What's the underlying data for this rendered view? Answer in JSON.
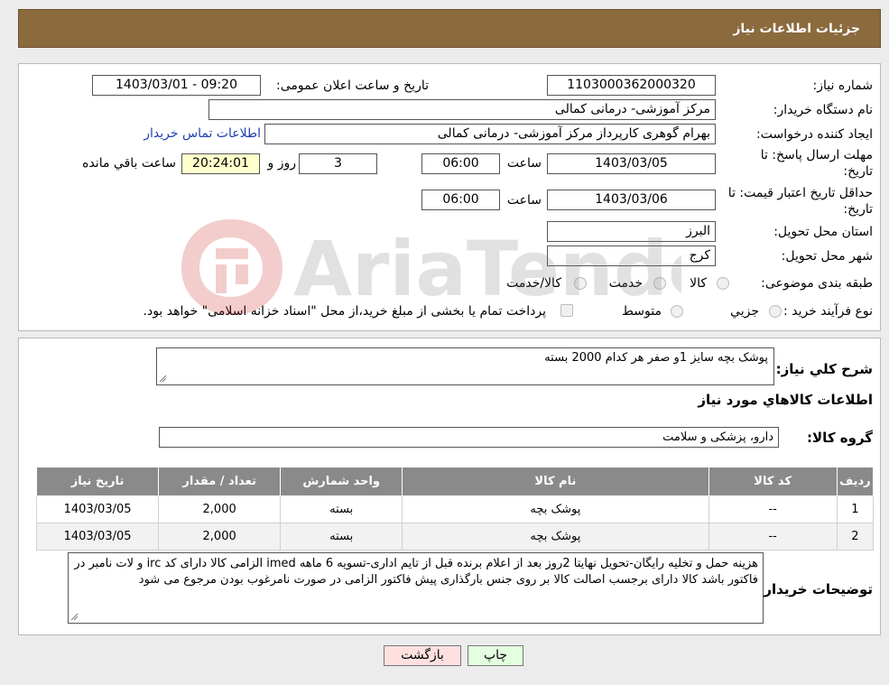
{
  "header": {
    "title": "جزئیات اطلاعات نیاز"
  },
  "form": {
    "need_number_label": "شماره نیاز:",
    "need_number": "1103000362000320",
    "announce_label": "تاریخ و ساعت اعلان عمومی:",
    "announce_value": "1403/03/01 - 09:20",
    "buyer_org_label": "نام دستگاه خریدار:",
    "buyer_org": "مرکز آموزشی- درمانی کمالی",
    "creator_label": "ایجاد کننده درخواست:",
    "creator": "بهرام گوهری کارپرداز مرکز آموزشی- درمانی کمالی",
    "contact_link": "اطلاعات تماس خریدار",
    "deadline_label_1": "مهلت ارسال پاسخ: تا",
    "deadline_label_2": "تاریخ:",
    "deadline_date": "1403/03/05",
    "time_label": "ساعت",
    "deadline_time": "06:00",
    "days_value": "3",
    "days_label": "روز و",
    "remaining_time": "20:24:01",
    "remaining_label": "ساعت باقي مانده",
    "validity_label_1": "حداقل تاریخ اعتبار قیمت: تا",
    "validity_label_2": "تاریخ:",
    "validity_date": "1403/03/06",
    "validity_time": "06:00",
    "province_label": "استان محل تحویل:",
    "province": "البرز",
    "city_label": "شهر محل تحویل:",
    "city": "کرج",
    "category_label": "طبقه بندی موضوعی:",
    "category_options": [
      "کالا",
      "خدمت",
      "کالا/خدمت"
    ],
    "process_label": "نوع فرآیند خرید :",
    "process_options": [
      "جزیي",
      "متوسط"
    ],
    "process_note": "پرداخت تمام یا بخشی از مبلغ خرید،از محل \"اسناد خزانه اسلامی\" خواهد بود."
  },
  "watermark": {
    "text": "AriaTender.neT"
  },
  "details": {
    "description_label": "شرح كلي نياز:",
    "description": "پوشک بچه سایز 1و صفر هر کدام 2000 بسته",
    "goods_info_title": "اطلاعات کالاهاي مورد نياز",
    "goods_group_label": "گروه کالا:",
    "goods_group": "دارو، پزشکی و سلامت",
    "table": {
      "headers": [
        "ردیف",
        "کد کالا",
        "نام کالا",
        "واحد شمارش",
        "تعداد / مقدار",
        "تاریخ نیاز"
      ],
      "rows": [
        [
          "1",
          "--",
          "پوشک بچه",
          "بسته",
          "2,000",
          "1403/03/05"
        ],
        [
          "2",
          "--",
          "پوشک بچه",
          "بسته",
          "2,000",
          "1403/03/05"
        ]
      ]
    },
    "buyer_notes_label": "توضیحات خریدار:",
    "buyer_notes": "هزینه حمل و تخلیه رایگان-تحویل نهایتا 2روز بعد از اعلام برنده قبل از تایم اداری-تسویه 6 ماهه imed الزامی کالا دارای کد irc و لات نامبر در فاکتور باشد کالا دارای برجسب اصالت کالا بر روی جنس بارگذاری پیش فاکتور الزامی در صورت نامرغوب بودن مرجوع می شود"
  },
  "buttons": {
    "print": "چاپ",
    "back": "بازگشت"
  }
}
